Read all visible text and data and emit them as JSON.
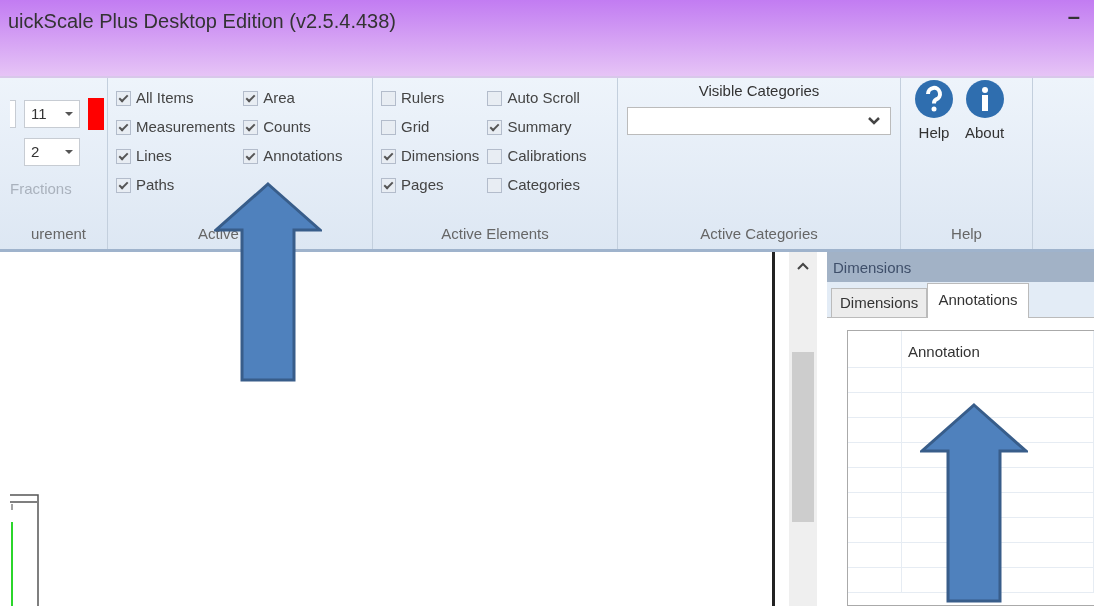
{
  "window": {
    "title": "uickScale Plus Desktop Edition (v2.5.4.438)",
    "minimize": "–"
  },
  "ribbon": {
    "groups": [
      {
        "kind": "measure",
        "label": "urement",
        "dropdowns": [
          {
            "value": "11"
          },
          {
            "value": "2"
          }
        ],
        "fractions": {
          "text": "Fractions",
          "disabled": true
        }
      },
      {
        "kind": "checks",
        "label": "Active",
        "columns": [
          [
            {
              "label": "All Items",
              "checked": true
            },
            {
              "label": "Measurements",
              "checked": true
            },
            {
              "label": "Lines",
              "checked": true
            },
            {
              "label": "Paths",
              "checked": true
            }
          ],
          [
            {
              "label": "Area",
              "checked": true
            },
            {
              "label": "Counts",
              "checked": true
            },
            {
              "label": "Annotations",
              "checked": true
            }
          ]
        ]
      },
      {
        "kind": "checks",
        "label": "Active Elements",
        "columns": [
          [
            {
              "label": "Rulers",
              "checked": false
            },
            {
              "label": "Grid",
              "checked": false
            },
            {
              "label": "Dimensions",
              "checked": true
            },
            {
              "label": "Pages",
              "checked": true
            }
          ],
          [
            {
              "label": "Auto Scroll",
              "checked": false
            },
            {
              "label": "Summary",
              "checked": true
            },
            {
              "label": "Calibrations",
              "checked": false
            },
            {
              "label": "Categories",
              "checked": false
            }
          ]
        ]
      },
      {
        "kind": "categories",
        "label": "Active Categories",
        "caption": "Visible Categories"
      },
      {
        "kind": "help",
        "label": "Help",
        "buttons": [
          {
            "kind": "help",
            "label": "Help"
          },
          {
            "kind": "about",
            "label": "About"
          }
        ]
      }
    ]
  },
  "panel": {
    "title": "Dimensions",
    "tabs": [
      {
        "label": "Dimensions",
        "selected": false
      },
      {
        "label": "Annotations",
        "selected": true
      }
    ],
    "table": {
      "columns": [
        "Annotation"
      ]
    }
  }
}
